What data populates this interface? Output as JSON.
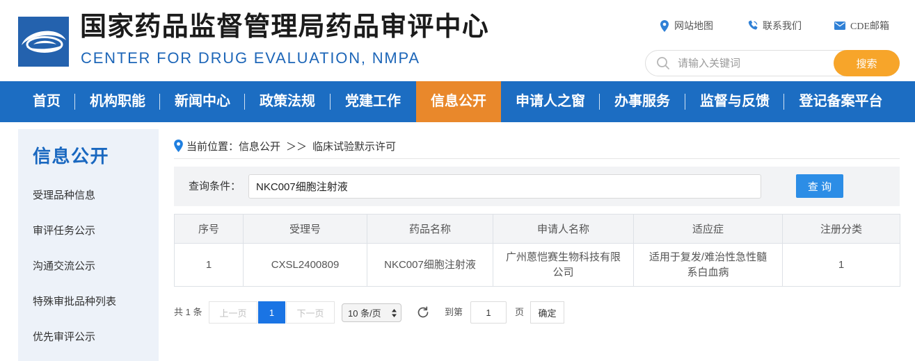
{
  "header": {
    "title": "国家药品监督管理局药品审评中心",
    "subtitle": "CENTER FOR DRUG EVALUATION, NMPA",
    "links": [
      {
        "label": "网站地图",
        "icon": "location-pin-icon"
      },
      {
        "label": "联系我们",
        "icon": "phone-icon"
      },
      {
        "label": "CDE邮箱",
        "icon": "mail-icon"
      }
    ],
    "search": {
      "placeholder": "请输入关键词",
      "button_label": "搜索",
      "icon": "search-icon"
    }
  },
  "nav": {
    "items": [
      {
        "label": "首页"
      },
      {
        "label": "机构职能"
      },
      {
        "label": "新闻中心"
      },
      {
        "label": "政策法规"
      },
      {
        "label": "党建工作"
      },
      {
        "label": "信息公开",
        "active": true
      },
      {
        "label": "申请人之窗"
      },
      {
        "label": "办事服务"
      },
      {
        "label": "监督与反馈"
      },
      {
        "label": "登记备案平台"
      }
    ]
  },
  "sidebar": {
    "title": "信息公开",
    "items": [
      "受理品种信息",
      "审评任务公示",
      "沟通交流公示",
      "特殊审批品种列表",
      "优先审评公示"
    ]
  },
  "breadcrumb": {
    "icon": "location-pin-icon",
    "label": "当前位置：",
    "items": [
      "信息公开",
      "临床试验默示许可"
    ],
    "separator": "＞＞"
  },
  "query": {
    "label": "查询条件：",
    "value": "NKC007细胞注射液",
    "button_label": "查 询"
  },
  "table": {
    "columns": [
      "序号",
      "受理号",
      "药品名称",
      "申请人名称",
      "适应症",
      "注册分类"
    ],
    "rows": [
      {
        "index": "1",
        "acceptance_no": "CXSL2400809",
        "drug_name": "NKC007细胞注射液",
        "applicant": "广州蒽恺赛生物科技有限公司",
        "indication": "适用于复发/难治性急性髓系白血病",
        "registration_category": "1"
      }
    ]
  },
  "pagination": {
    "total_label": "共 1 条",
    "prev_label": "上一页",
    "current_page": "1",
    "next_label": "下一页",
    "page_size": "10 条/页",
    "goto_label": "到第",
    "goto_value": "1",
    "page_unit": "页",
    "confirm_label": "确定",
    "refresh_icon": "refresh-icon"
  },
  "colors": {
    "nav_bg": "#1c6dc2",
    "nav_active": "#e9882b",
    "search_button": "#f7a52a",
    "accent": "#1a68c0",
    "subtitle": "#1d66b8",
    "query_button": "#2c8de6",
    "page_active": "#1a74e4",
    "icon_blue": "#2f80d6"
  }
}
